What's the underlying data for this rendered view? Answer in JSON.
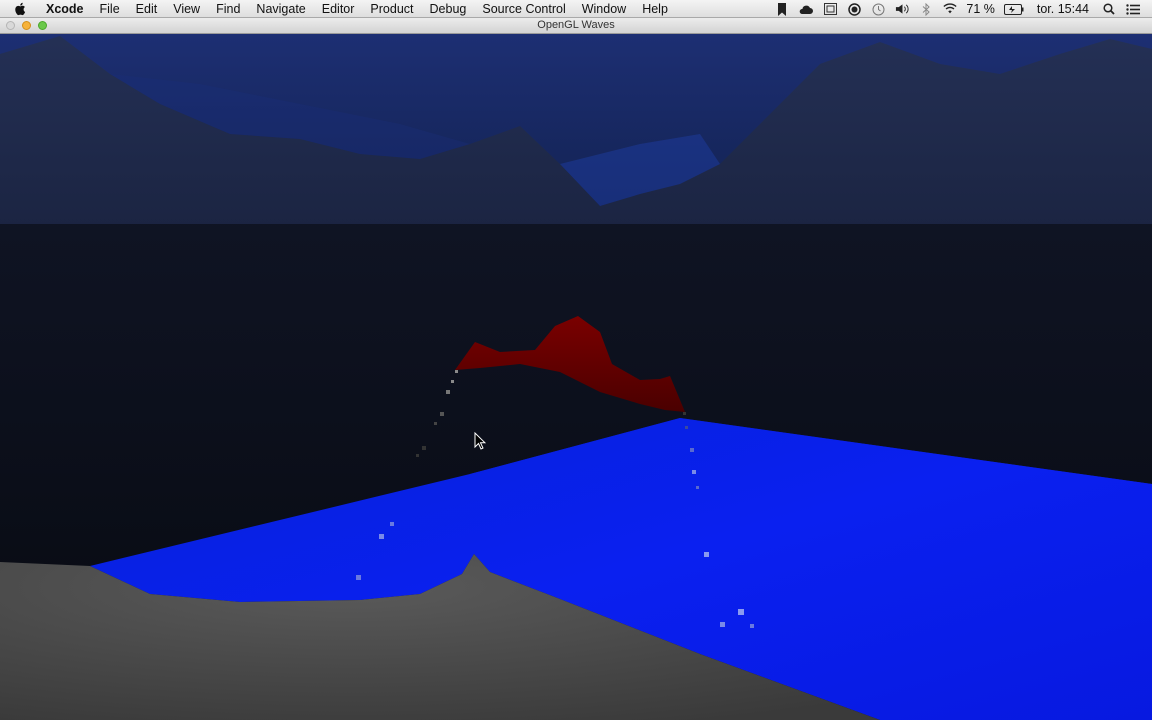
{
  "menubar": {
    "apple_icon": "apple-icon",
    "app_name": "Xcode",
    "items": [
      "File",
      "Edit",
      "View",
      "Find",
      "Navigate",
      "Editor",
      "Product",
      "Debug",
      "Source Control",
      "Window",
      "Help"
    ],
    "status": {
      "icons": [
        "bookmark-icon",
        "cloud-icon",
        "screen-icon",
        "record-icon",
        "time-machine-icon",
        "volume-icon",
        "bluetooth-icon",
        "wifi-icon"
      ],
      "battery_percent": "71 %",
      "battery_icon": "battery-icon",
      "clock": "tor. 15:44",
      "search_icon": "spotlight-icon",
      "list_icon": "notification-center-icon"
    }
  },
  "window": {
    "title": "OpenGL Waves",
    "buttons": [
      "close",
      "minimize",
      "zoom"
    ]
  },
  "scene": {
    "sky_color": "#1a2c6e",
    "water_color": "#0022ff",
    "ground_color": "#4a4a4a",
    "object_color": "#6a0000"
  }
}
